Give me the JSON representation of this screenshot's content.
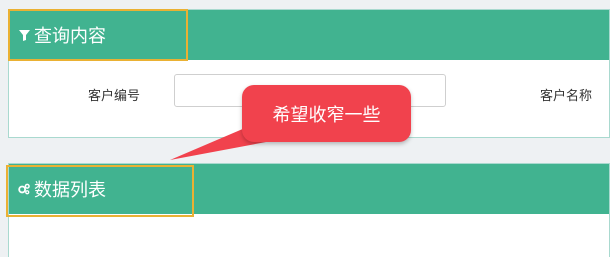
{
  "query_panel": {
    "title": "查询内容",
    "icon": "filter-icon",
    "fields": [
      {
        "label": "客户编号",
        "value": "",
        "placeholder": ""
      },
      {
        "label": "客户名称",
        "value": "",
        "placeholder": ""
      }
    ]
  },
  "list_panel": {
    "title": "数据列表",
    "icon": "cogs-icon"
  },
  "callout": {
    "text": "希望收窄一些"
  },
  "colors": {
    "header_green": "#41b390",
    "highlight_border": "#eab133",
    "callout_red": "#f1424d"
  }
}
